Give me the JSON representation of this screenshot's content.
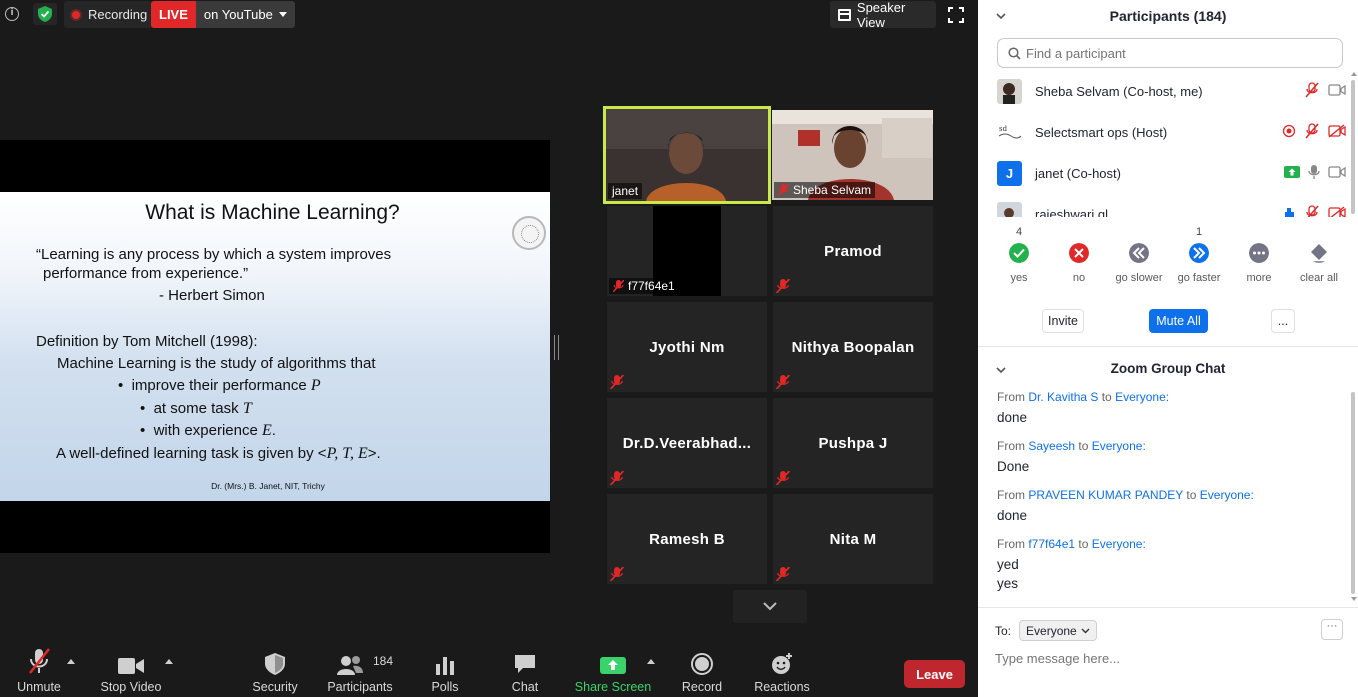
{
  "topbar": {
    "recording_label": "Recording",
    "live_label": "LIVE",
    "live_destination": "on YouTube",
    "speaker_view_label": "Speaker View"
  },
  "slide": {
    "title": "What is Machine Learning?",
    "quote_line1": "“Learning is any process by which a system improves",
    "quote_line2": "performance from experience.”",
    "quote_author": "- Herbert Simon",
    "definition_heading": "Definition by Tom Mitchell (1998):",
    "definition_line": "Machine Learning is the study of algorithms that",
    "bullet1_text": "improve their performance",
    "bullet1_var": "P",
    "bullet2_text": "at some task",
    "bullet2_var": "T",
    "bullet3_text": "with experience",
    "bullet3_var": "E",
    "bullet3_suffix": ".",
    "conclusion_text": "A well-defined learning task is given by <",
    "conclusion_vars": "P, T, E",
    "conclusion_suffix": ">.",
    "footer": "Dr. (Mrs.) B. Janet, NIT, Trichy"
  },
  "gallery": {
    "janet": "janet",
    "sheba": "Sheba Selvam",
    "f77": "f77f64e1",
    "pramod": "Pramod",
    "jyothi": "Jyothi Nm",
    "nithya": "Nithya Boopalan",
    "veera": "Dr.D.Veerabhad...",
    "pushpa": "Pushpa J",
    "ramesh": "Ramesh B",
    "nita": "Nita M"
  },
  "toolbar": {
    "unmute": "Unmute",
    "stop_video": "Stop Video",
    "security": "Security",
    "participants": "Participants",
    "participants_count": "184",
    "polls": "Polls",
    "chat": "Chat",
    "share_screen": "Share Screen",
    "record": "Record",
    "reactions": "Reactions",
    "leave": "Leave"
  },
  "participants_panel": {
    "title": "Participants (184)",
    "search_placeholder": "Find a participant",
    "rows": [
      {
        "name": "Sheba Selvam (Co-host, me)"
      },
      {
        "name": "Selectsmart ops (Host)"
      },
      {
        "name": "janet (Co-host)",
        "avatar_letter": "J"
      },
      {
        "name": "rajeshwari gl"
      }
    ],
    "reactions": [
      {
        "label": "yes",
        "count": "4"
      },
      {
        "label": "no",
        "count": ""
      },
      {
        "label": "go slower",
        "count": ""
      },
      {
        "label": "go faster",
        "count": "1"
      },
      {
        "label": "more",
        "count": ""
      },
      {
        "label": "clear all",
        "count": ""
      }
    ],
    "invite": "Invite",
    "mute_all": "Mute All",
    "more": "..."
  },
  "chat": {
    "title": "Zoom Group Chat",
    "from_word": "From",
    "to_word": "to",
    "messages": [
      {
        "sender": "Dr. Kavitha S",
        "recipient": "Everyone:",
        "lines": [
          "done"
        ]
      },
      {
        "sender": "Sayeesh",
        "recipient": "Everyone:",
        "lines": [
          "Done"
        ]
      },
      {
        "sender": "PRAVEEN KUMAR PANDEY",
        "recipient": "Everyone:",
        "lines": [
          "done"
        ]
      },
      {
        "sender": "f77f64e1",
        "recipient": "Everyone:",
        "lines": [
          "yed",
          "yes"
        ]
      }
    ],
    "to_label": "To:",
    "to_value": "Everyone",
    "more": "···",
    "input_placeholder": "Type message here..."
  },
  "colors": {
    "accent_blue": "#0e71eb",
    "live_red": "#e02828",
    "leave_red": "#c0262d",
    "share_green": "#3ad36b",
    "active_speaker": "#c9e94b"
  }
}
